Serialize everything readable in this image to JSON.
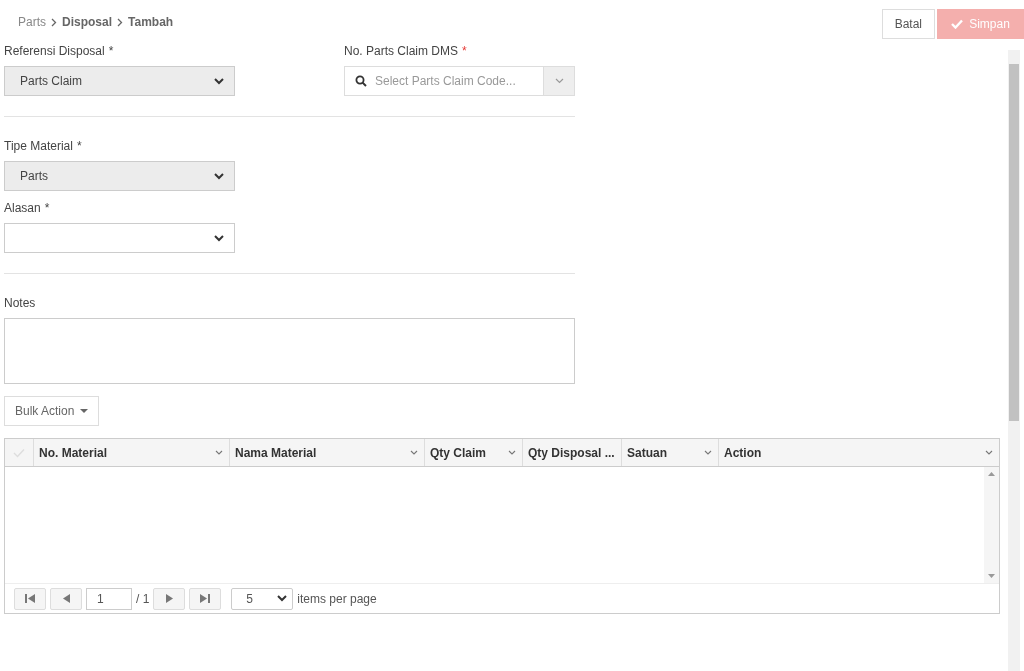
{
  "breadcrumb": [
    {
      "label": "Parts",
      "current": false
    },
    {
      "label": "Disposal",
      "current": true
    },
    {
      "label": "Tambah",
      "current": true
    }
  ],
  "actions": [
    {
      "label": "Batal",
      "kind": "cancel",
      "disabled": false
    },
    {
      "label": "Simpan",
      "kind": "save",
      "disabled": true
    }
  ],
  "fields": [
    {
      "kind": "select",
      "label": "Referensi Disposal",
      "marker": "*",
      "marker_highlight": false,
      "value": "Parts Claim",
      "disabled": true
    },
    {
      "kind": "combo",
      "label": "No. Parts Claim DMS",
      "marker": "*",
      "marker_highlight": true,
      "placeholder": "Select Parts Claim Code..."
    },
    {
      "kind": "divider"
    },
    {
      "kind": "select",
      "label": "Tipe Material",
      "marker": "*",
      "marker_highlight": false,
      "value": "Parts",
      "disabled": true
    },
    {
      "kind": "select",
      "label": "Alasan",
      "marker": "*",
      "marker_highlight": false,
      "disabled": false
    },
    {
      "kind": "divider"
    },
    {
      "kind": "textarea",
      "label": "Notes"
    }
  ],
  "bulk_action": {
    "label": "Bulk Action"
  },
  "table": {
    "columns": [
      "No. Material",
      "Nama Material",
      "Qty Claim",
      "Qty Disposal ...",
      "Satuan",
      "Action"
    ]
  },
  "pager": {
    "page": "1",
    "of": "/ 1",
    "page_size": "5",
    "suffix": "items per page"
  }
}
